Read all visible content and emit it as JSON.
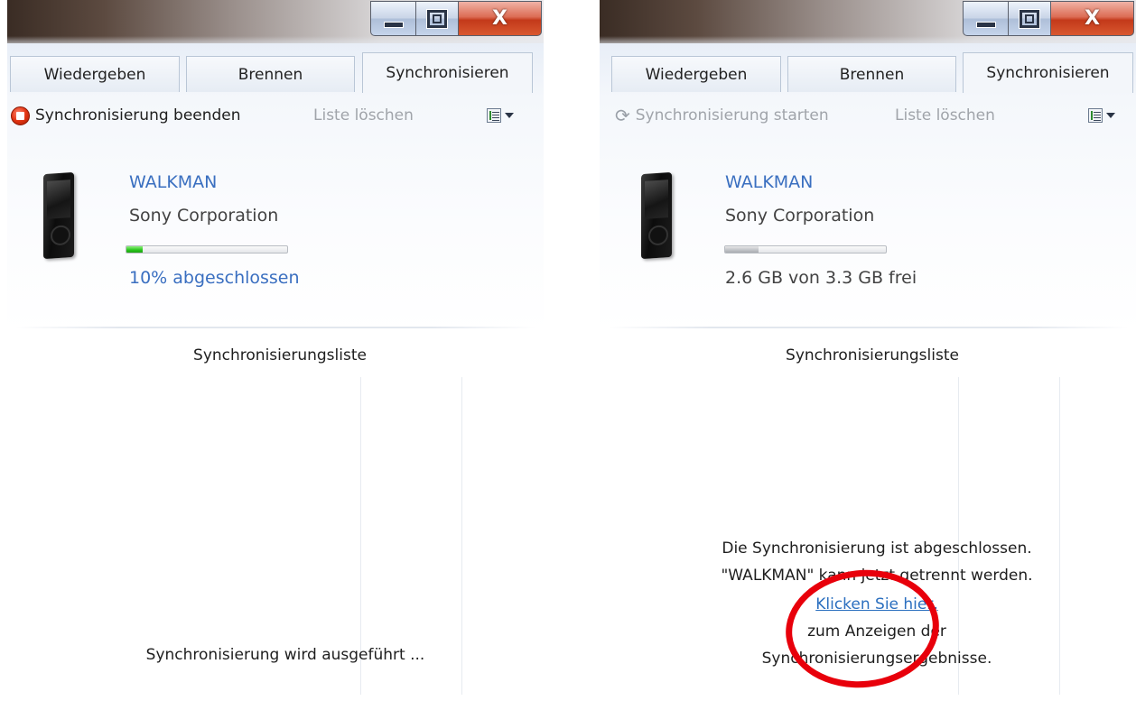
{
  "panels": [
    {
      "tabs": [
        {
          "label": "Wiedergeben",
          "active": false
        },
        {
          "label": "Brennen",
          "active": false
        },
        {
          "label": "Synchronisieren",
          "active": true
        }
      ],
      "toolbar": {
        "primary_label": "Synchronisierung beenden",
        "primary_icon": "stop-icon",
        "clear_label": "Liste löschen",
        "options_icon": "list-options-icon"
      },
      "device": {
        "name": "WALKMAN",
        "manufacturer": "Sony Corporation",
        "progress": 0.1,
        "status": "10% abgeschlossen"
      },
      "list_header": "Synchronisierungsliste",
      "message_lines": [
        "Synchronisierung wird ausgeführt ..."
      ]
    },
    {
      "tabs": [
        {
          "label": "Wiedergeben",
          "active": false
        },
        {
          "label": "Brennen",
          "active": false
        },
        {
          "label": "Synchronisieren",
          "active": true
        }
      ],
      "toolbar": {
        "primary_label": "Synchronisierung starten",
        "primary_icon": "sync-arrows-icon",
        "clear_label": "Liste löschen",
        "options_icon": "list-options-icon"
      },
      "device": {
        "name": "WALKMAN",
        "manufacturer": "Sony Corporation",
        "capacity_used": 0.21,
        "status": "2.6 GB von 3.3 GB frei"
      },
      "list_header": "Synchronisierungsliste",
      "message_lines": [
        "Die Synchronisierung ist abgeschlossen.",
        "\"WALKMAN\" kann jetzt getrennt werden.",
        "Klicken Sie hier,",
        "zum Anzeigen der",
        "Synchronisierungsergebnisse."
      ]
    }
  ],
  "window_controls": {
    "close_glyph": "X"
  },
  "colors": {
    "link_blue": "#3a6fc0",
    "stop_red": "#e23412",
    "progress_green": "#27c41a",
    "annotation_red": "#e8000b"
  }
}
